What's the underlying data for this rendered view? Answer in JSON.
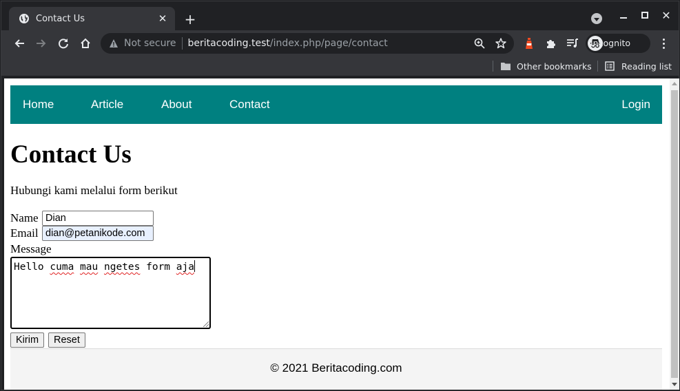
{
  "browser": {
    "tab": {
      "title": "Contact Us",
      "icon": "globe-icon"
    },
    "new_tab_symbol": "+",
    "address": {
      "security_label": "Not secure",
      "host": "beritacoding.test",
      "path": "/index.php/page/contact"
    },
    "profile_label": "Incognito",
    "bookmarks": [
      {
        "label": "Other bookmarks",
        "icon": "folder-icon"
      },
      {
        "label": "Reading list",
        "icon": "reading-list-icon"
      }
    ]
  },
  "page": {
    "nav": {
      "items": [
        "Home",
        "Article",
        "About",
        "Contact"
      ],
      "login": "Login",
      "color": "#008080"
    },
    "title": "Contact Us",
    "intro": "Hubungi kami melalui form berikut",
    "form": {
      "name_label": "Name",
      "name_value": "Dian",
      "email_label": "Email",
      "email_value": "dian@petanikode.com",
      "message_label": "Message",
      "message_words": [
        "Hello",
        "cuma",
        "mau",
        "ngetes",
        "form",
        "aja"
      ],
      "submit_label": "Kirim",
      "reset_label": "Reset"
    },
    "footer": "© 2021 Beritacoding.com"
  }
}
